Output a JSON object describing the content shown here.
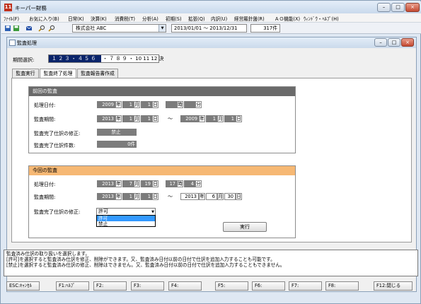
{
  "app": {
    "icon_text": "11",
    "title": "キーパー財務"
  },
  "window_controls": {
    "minimize": "–",
    "maximize": "□",
    "close": "×"
  },
  "menu": [
    "ﾌｧｲﾙ(F)",
    "お気に入り(B)",
    "日常(K)",
    "決算(K)",
    "消費税(T)",
    "分析(A)",
    "初期(S)",
    "拡張(Q)",
    "内訳(U)",
    "経営羅針盤(R)",
    "ＡＯ機能(X)",
    "ｳｨﾝﾄﾞｳ・ﾍﾙﾌﾟ(H)"
  ],
  "toolbar": {
    "company": "株式会社 ABC",
    "period": "2013/01/01 ～ 2013/12/31",
    "count": "317件",
    "icons": [
      "save-icon",
      "save-all-icon",
      "mail-icon",
      "search-icon",
      "search-next-icon"
    ]
  },
  "inner_window": {
    "title": "監査処理"
  },
  "period_select": {
    "label": "期間選択:",
    "highlighted": "１ ２ ３ ・ ４ ５ ６",
    "rest": "・ ７ ８ ９ ・ 10 11 12 決"
  },
  "tabs": [
    "監査実行",
    "監査終了処理",
    "監査報告書作成"
  ],
  "active_tab": 1,
  "previous_audit": {
    "title": "前回の監査",
    "processing_date_label": "処理日付:",
    "processing_date": {
      "year": "2009",
      "month": "1",
      "day": "1",
      "hour": "",
      "minute": ""
    },
    "audit_period_label": "監査期間:",
    "audit_period_from": {
      "year": "2013",
      "month": "1",
      "day": "1"
    },
    "audit_period_to": {
      "year": "2009",
      "month": "1",
      "day": "1"
    },
    "modify_label": "監査完了仕訳の修正:",
    "modify_value": "禁止",
    "count_label": "監査完了仕訳件数:",
    "count_value": "0件"
  },
  "current_audit": {
    "title": "今回の監査",
    "processing_date_label": "処理日付:",
    "processing_date": {
      "year": "2013",
      "month": "7",
      "day": "19",
      "hour": "17",
      "minute": "4"
    },
    "audit_period_label": "監査期間:",
    "audit_period_from": {
      "year": "2013",
      "month": "1",
      "day": "1"
    },
    "audit_period_to": {
      "year": "2013",
      "month": "6",
      "day": "30"
    },
    "modify_label": "監査完了仕訳の修正:",
    "modify_value": "許可",
    "modify_options": [
      "許可",
      "禁止"
    ],
    "execute_button": "実行"
  },
  "units": {
    "year": "年",
    "month": "月",
    "day": "日",
    "hour": "時",
    "minute": "分",
    "tilde": "～"
  },
  "message": [
    "監査済み仕訳の取り扱いを選択します。",
    "[許可]を選択すると監査済み仕訳を修正、削除ができます。又、監査済み日付以前の日付で仕訳を追加入力することも可能です。",
    "[禁止]を選択すると監査済み仕訳の修正、削除はできません。又、監査済み日付以前の日付で仕訳を追加入力することもできません。"
  ],
  "function_keys": [
    "ESC:ｷｬﾝｾﾙ",
    "F1:ﾍﾙﾌﾟ",
    "F2:",
    "F3:",
    "F4:",
    "F5:",
    "F6:",
    "F7:",
    "F8:",
    "F12:閉じる"
  ]
}
